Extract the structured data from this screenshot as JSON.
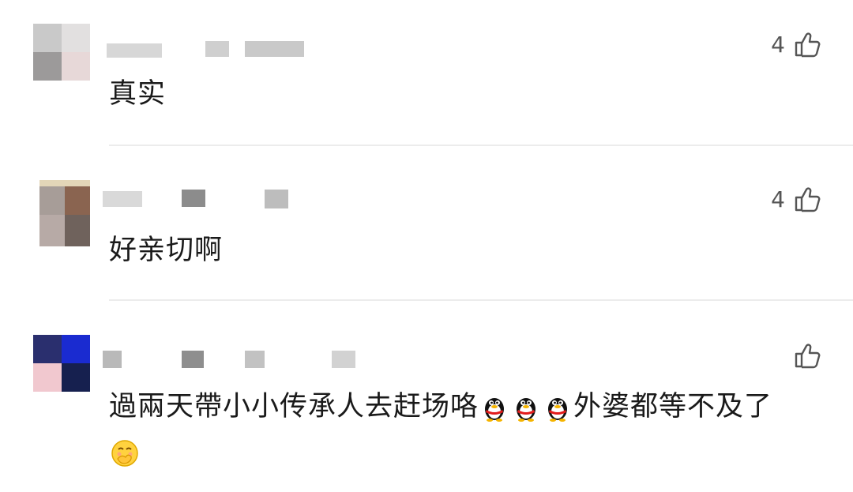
{
  "comments": [
    {
      "text": "真实",
      "likes": "4"
    },
    {
      "text": "好亲切啊",
      "likes": "4"
    },
    {
      "text_part1": "過兩天帶小小传承人去赶场咯",
      "text_part2": "外婆都等不及了",
      "likes": ""
    }
  ],
  "icons": {
    "like": "thumbs-up-icon",
    "emoji_qq": "qq-penguin-emoji",
    "emoji_hehe": "giggle-face-emoji"
  }
}
